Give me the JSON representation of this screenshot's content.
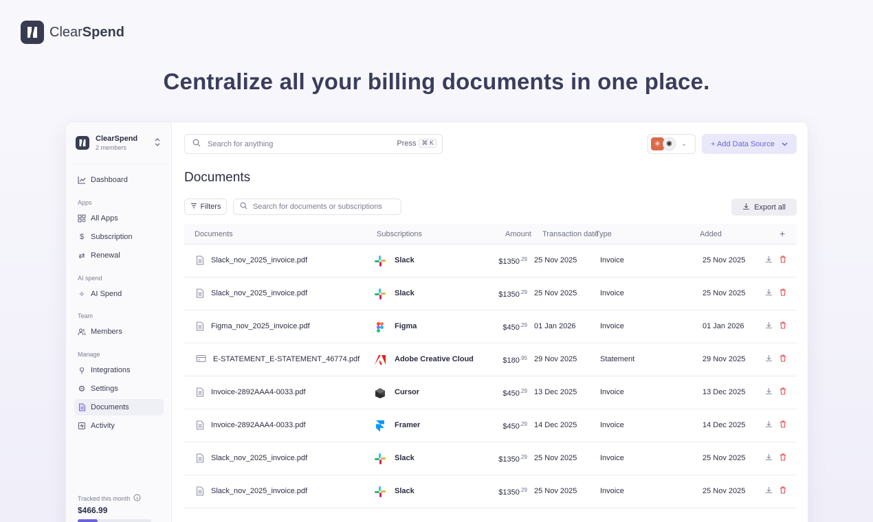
{
  "brand": {
    "name_light": "Clear",
    "name_bold": "Spend"
  },
  "hero": {
    "title": "Centralize all your billing documents in one place."
  },
  "workspace": {
    "name": "ClearSpend",
    "members": "2 members"
  },
  "nav": {
    "dashboard": "Dashboard",
    "apps_section": "Apps",
    "all_apps": "All Apps",
    "subscription": "Subscription",
    "renewal": "Renewal",
    "ai_section": "AI spend",
    "ai_spend": "AI Spend",
    "team_section": "Team",
    "members": "Members",
    "manage_section": "Manage",
    "integrations": "Integrations",
    "settings": "Settings",
    "documents": "Documents",
    "activity": "Activity"
  },
  "tracked": {
    "label": "Tracked this month",
    "amount": "$466.99",
    "progress": 0.27
  },
  "topbar": {
    "search_placeholder": "Search for anything",
    "press": "Press",
    "shortcut": "⌘ K",
    "add_source": "+ Add Data Source"
  },
  "page": {
    "title": "Documents",
    "filters": "Filters",
    "doc_search_placeholder": "Search for documents or subscriptions",
    "export": "Export all"
  },
  "table": {
    "headers": {
      "documents": "Documents",
      "subscriptions": "Subscriptions",
      "amount": "Amount",
      "transaction_date": "Transaction date",
      "type": "Type",
      "added": "Added",
      "add": "+"
    },
    "rows": [
      {
        "doc": "Slack_nov_2025_invoice.pdf",
        "sub": "Slack",
        "amt_main": "$1350",
        "amt_dec": ".29",
        "date": "25 Nov 2025",
        "type": "Invoice",
        "added": "25 Nov 2025",
        "icon": "slack"
      },
      {
        "doc": "Slack_nov_2025_invoice.pdf",
        "sub": "Slack",
        "amt_main": "$1350",
        "amt_dec": ".29",
        "date": "25 Nov 2025",
        "type": "Invoice",
        "added": "25 Nov 2025",
        "icon": "slack"
      },
      {
        "doc": "Figma_nov_2025_invoice.pdf",
        "sub": "Figma",
        "amt_main": "$450",
        "amt_dec": ".29",
        "date": "01 Jan 2026",
        "type": "Invoice",
        "added": "01 Jan 2026",
        "icon": "figma"
      },
      {
        "doc": "E-STATEMENT_E-STATEMENT_46774.pdf",
        "sub": "Adobe Creative Cloud",
        "amt_main": "$180",
        "amt_dec": ".95",
        "date": "29 Nov 2025",
        "type": "Statement",
        "added": "29 Nov 2025",
        "icon": "adobe"
      },
      {
        "doc": "Invoice-2892AAA4-0033.pdf",
        "sub": "Cursor",
        "amt_main": "$450",
        "amt_dec": ".29",
        "date": "13 Dec 2025",
        "type": "Invoice",
        "added": "13 Dec 2025",
        "icon": "cursor"
      },
      {
        "doc": "Invoice-2892AAA4-0033.pdf",
        "sub": "Framer",
        "amt_main": "$450",
        "amt_dec": ".29",
        "date": "14 Dec 2025",
        "type": "Invoice",
        "added": "14 Dec 2025",
        "icon": "framer"
      },
      {
        "doc": "Slack_nov_2025_invoice.pdf",
        "sub": "Slack",
        "amt_main": "$1350",
        "amt_dec": ".29",
        "date": "25 Nov 2025",
        "type": "Invoice",
        "added": "25 Nov 2025",
        "icon": "slack"
      },
      {
        "doc": "Slack_nov_2025_invoice.pdf",
        "sub": "Slack",
        "amt_main": "$1350",
        "amt_dec": ".29",
        "date": "25 Nov 2025",
        "type": "Invoice",
        "added": "25 Nov 2025",
        "icon": "slack"
      }
    ]
  }
}
